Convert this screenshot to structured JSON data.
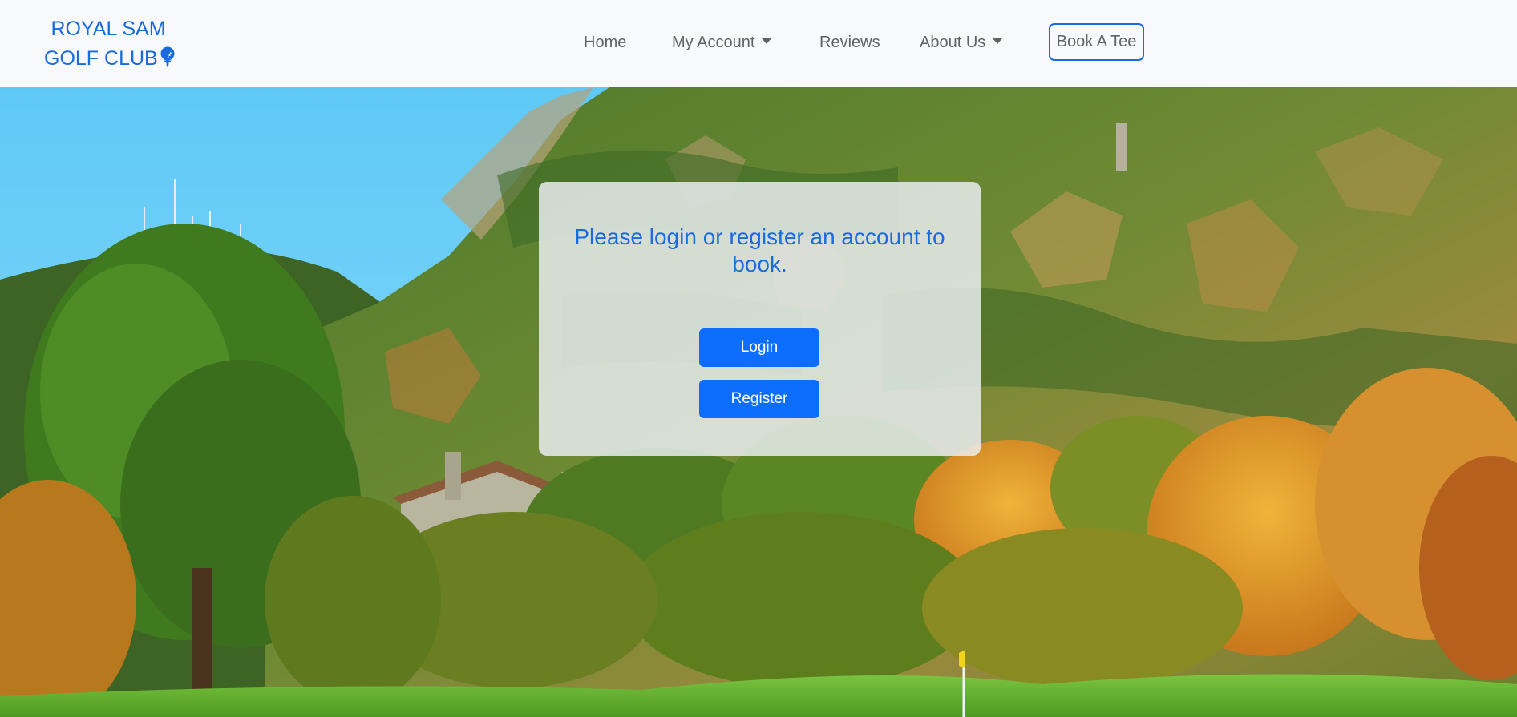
{
  "brand": {
    "line1": "ROYAL SAM",
    "line2": "GOLF CLUB",
    "icon": "golf-ball-tee-icon"
  },
  "nav": {
    "home": "Home",
    "my_account": "My Account",
    "reviews": "Reviews",
    "about_us": "About Us",
    "book_a_tee": "Book A Tee"
  },
  "hero": {
    "background": "mountain-golf-course-photo"
  },
  "panel": {
    "message": "Please login or register an account to book.",
    "login_label": "Login",
    "register_label": "Register"
  },
  "colors": {
    "brand_blue": "#1a6ae0",
    "button_blue": "#0d6efd",
    "navbar_bg": "#f8f9fa",
    "nav_text": "#5f6368"
  }
}
